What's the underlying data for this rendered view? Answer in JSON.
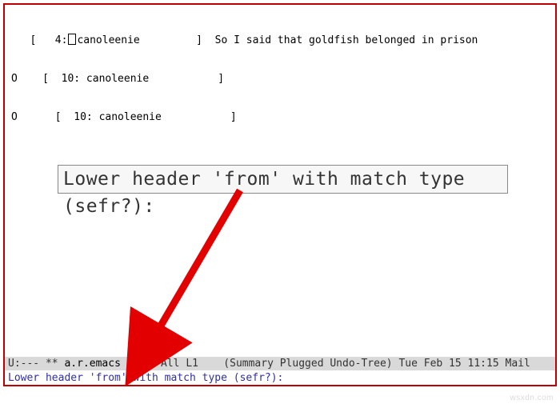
{
  "messages": {
    "line1_prefix": "   [   4:",
    "line1_user": "canoleenie",
    "line1_pad": "         ]  So I said that goldfish belonged in prison",
    "line2": "O    [  10: canoleenie           ]",
    "line3": "O      [  10: canoleenie           ]"
  },
  "callout": {
    "text": "Lower header 'from' with match type (sefr?):"
  },
  "modeline": {
    "left": "U:--- ",
    "dirty": "**",
    "filename": " a.r.emacs ",
    "right": "    All L1    (Summary Plugged Undo-Tree) Tue Feb 15 11:15 Mail"
  },
  "minibuffer": {
    "text": "Lower header 'from' with match type (sefr?):"
  },
  "watermark": {
    "text": "wsxdn.com"
  }
}
